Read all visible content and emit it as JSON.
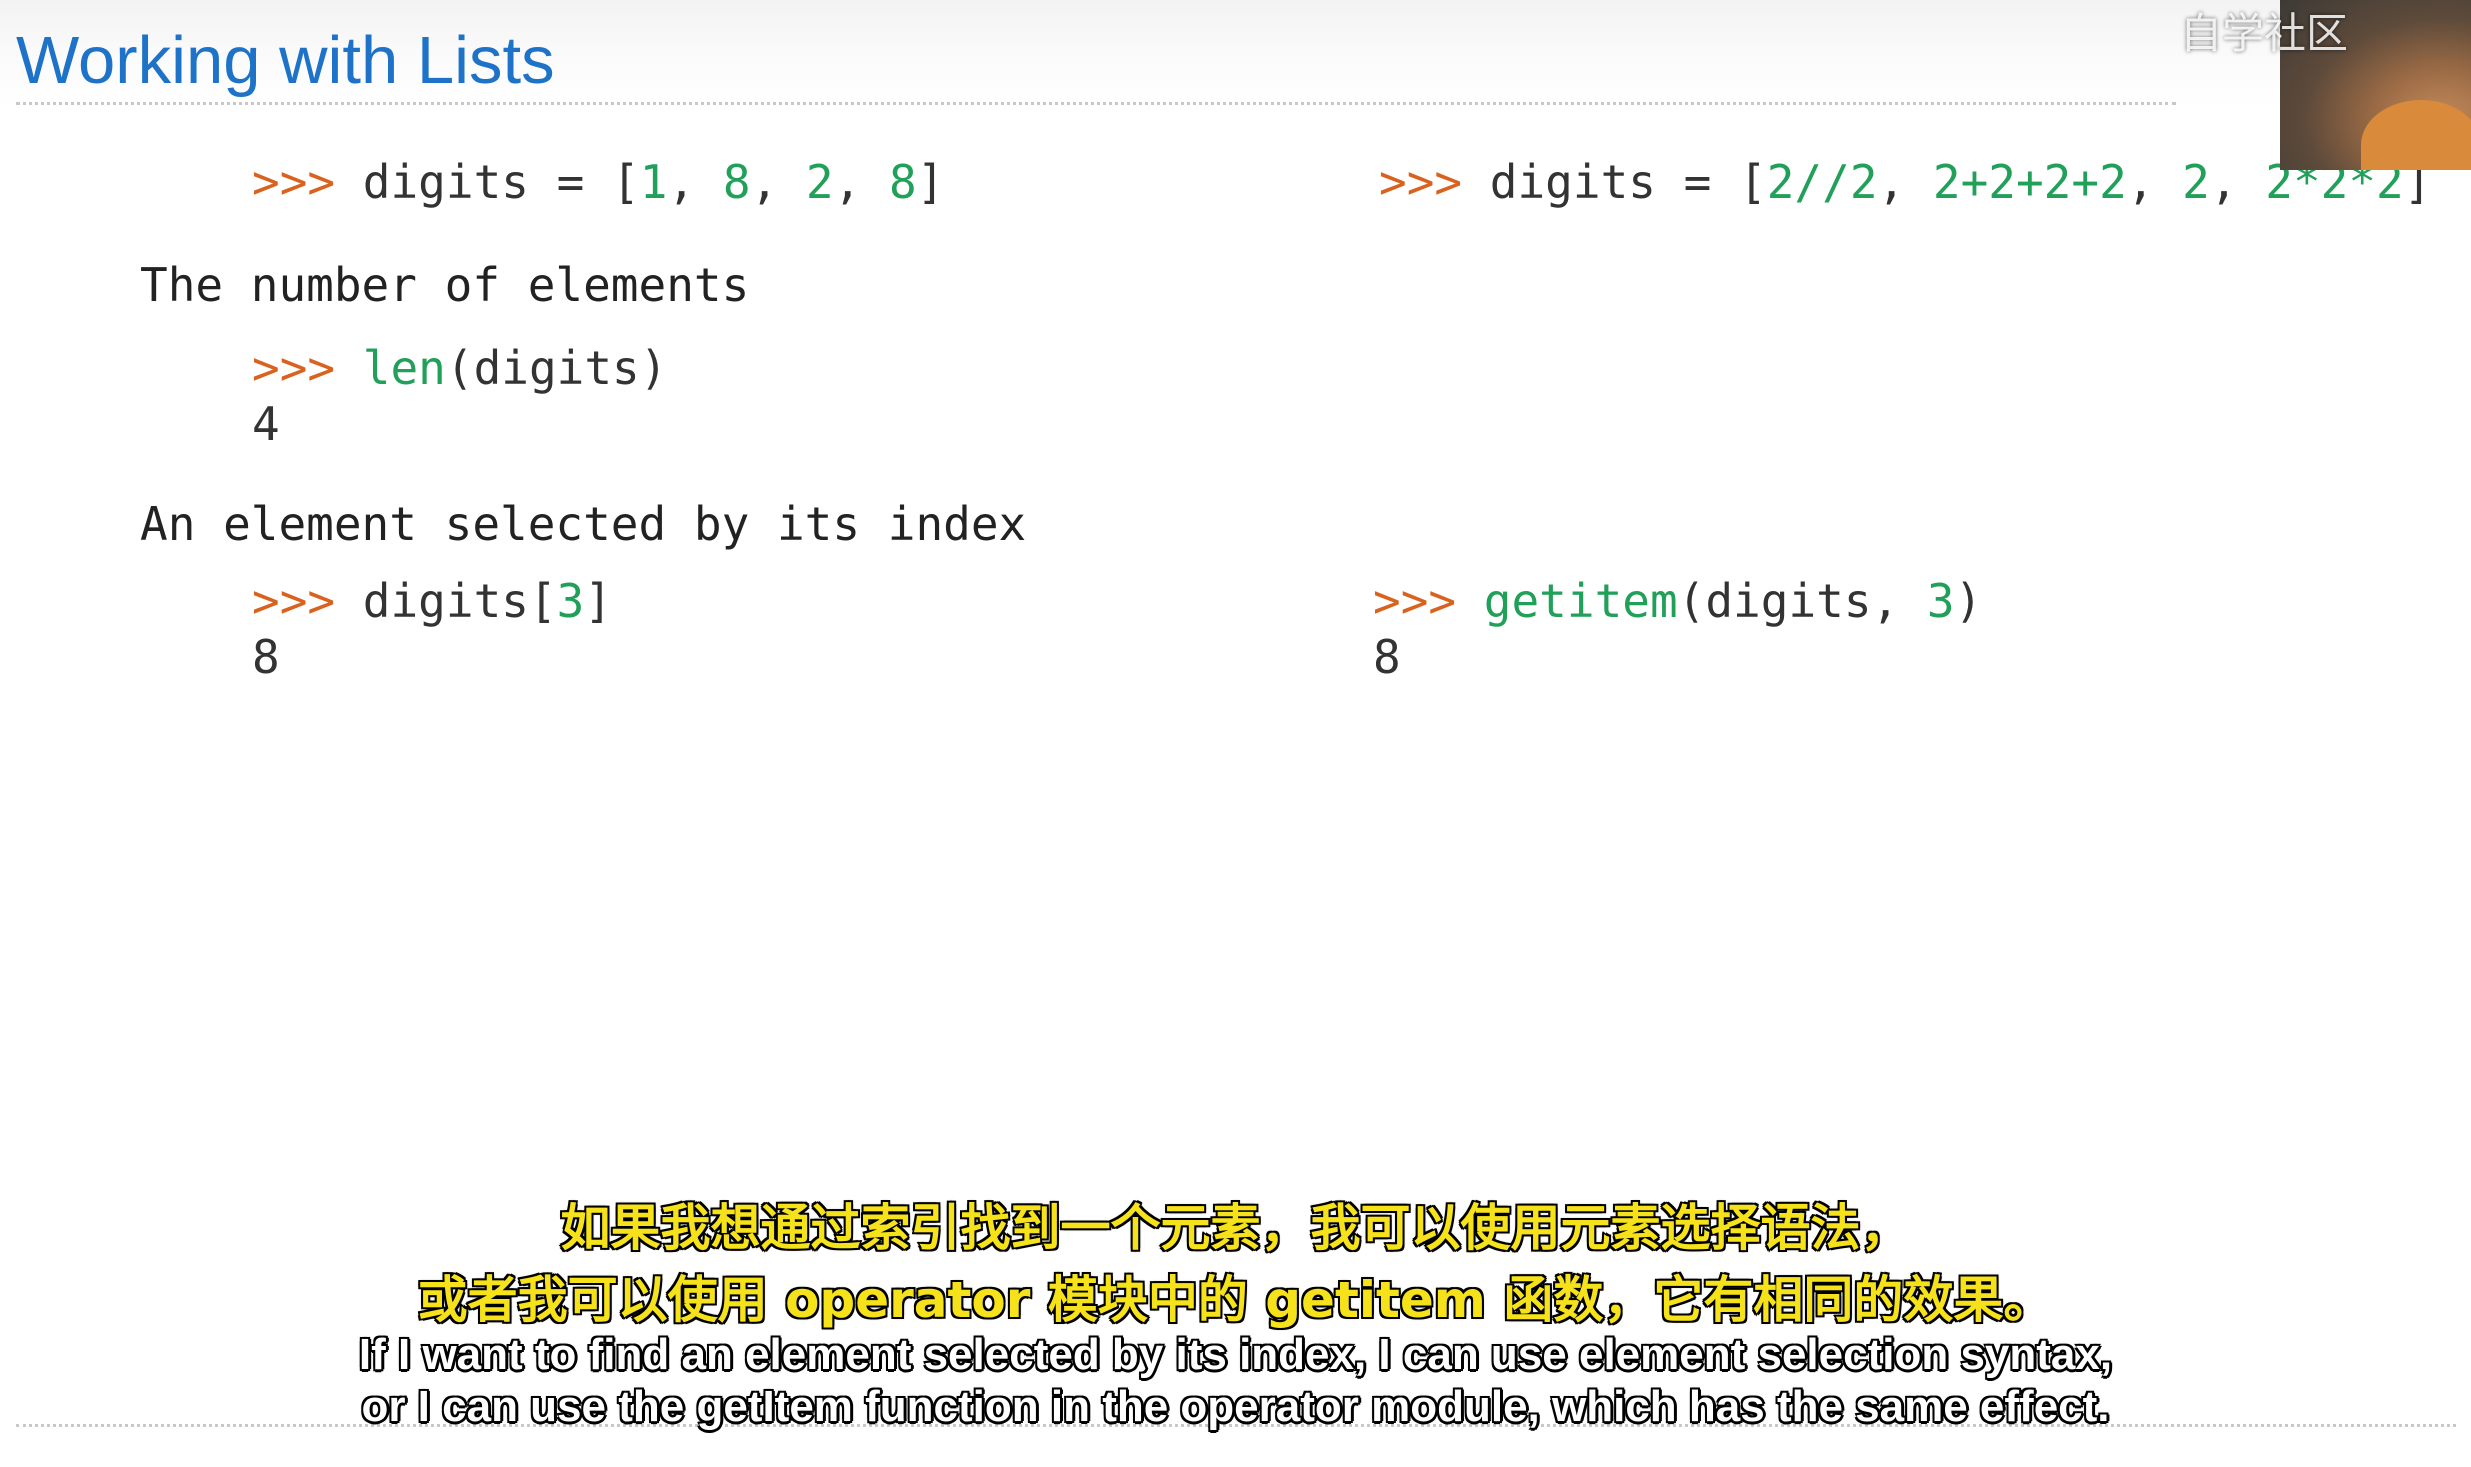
{
  "slide": {
    "title": "Working with Lists"
  },
  "code": {
    "prompt": ">>>",
    "left_def": {
      "pre": " digits = [",
      "n1": "1",
      "s1": ", ",
      "n2": "8",
      "s2": ", ",
      "n3": "2",
      "s3": ", ",
      "n4": "8",
      "post": "]"
    },
    "right_def": {
      "pre": " digits = [",
      "n1": "2//2",
      "s1": ", ",
      "n2": "2+2+2+2",
      "s2": ", ",
      "n3": "2",
      "s3": ", ",
      "n4": "2*2*2",
      "post": "]"
    },
    "label_count": "The number of elements",
    "len_fn": "len",
    "len_args": "(digits)",
    "len_result": "4",
    "label_index": "An element selected by its index",
    "index_pre": " digits[",
    "index_num": "3",
    "index_post": "]",
    "index_result": "8",
    "getitem_fn": "getitem",
    "getitem_pre": "(digits, ",
    "getitem_num": "3",
    "getitem_post": ")",
    "getitem_result": "8"
  },
  "subtitles": {
    "zh_line1": "如果我想通过索引找到一个元素，我可以使用元素选择语法，",
    "zh_line2": "或者我可以使用 operator 模块中的 getitem 函数，它有相同的效果。",
    "en_line1": "If I want to find an element selected by its index, I can use element selection syntax,",
    "en_line2": "or I can use the getItem function in the operator module, which has the same effect."
  },
  "overlay": {
    "watermark": "自学社区"
  },
  "colors": {
    "title": "#1e73c8",
    "prompt": "#d9621e",
    "number": "#21a05a",
    "text": "#333333",
    "subtitle_zh": "#f5e21a",
    "subtitle_en": "#ffffff"
  }
}
